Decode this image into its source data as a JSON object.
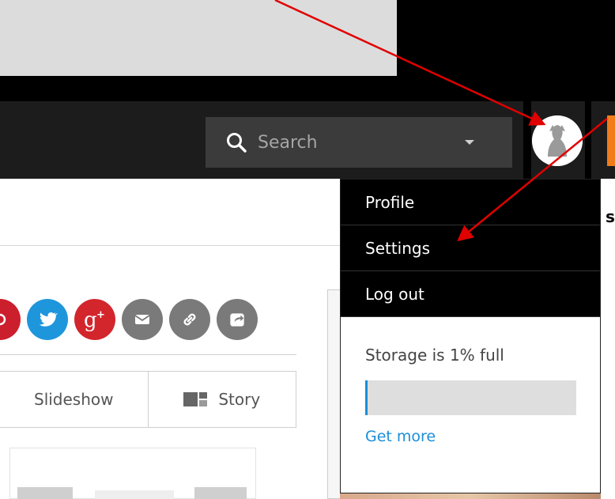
{
  "header": {
    "search": {
      "placeholder": "Search"
    }
  },
  "account_menu": {
    "items": [
      {
        "label": "Profile"
      },
      {
        "label": "Settings"
      },
      {
        "label": "Log out"
      }
    ],
    "storage": {
      "label": "Storage is 1% full",
      "percent_full": 1,
      "link": "Get more"
    }
  },
  "share_buttons": [
    {
      "icon": "pinterest-icon",
      "color": "#cc1f2d"
    },
    {
      "icon": "twitter-icon",
      "color": "#1e96dc"
    },
    {
      "icon": "google-plus-icon",
      "color": "#d2262c"
    },
    {
      "icon": "email-icon",
      "color": "#7a7a7a"
    },
    {
      "icon": "link-icon",
      "color": "#7a7a7a"
    },
    {
      "icon": "share-icon",
      "color": "#7a7a7a"
    }
  ],
  "view_tabs": [
    {
      "label": "Slideshow"
    },
    {
      "label": "Story",
      "icon": "story-layout-icon"
    }
  ],
  "partial_text": {
    "right_edge": "s"
  },
  "colors": {
    "accent": "#1a8fd8",
    "menu_bg": "#000000",
    "navbar_bg": "#1c1c1c",
    "annotation_arrow": "#e00000"
  }
}
